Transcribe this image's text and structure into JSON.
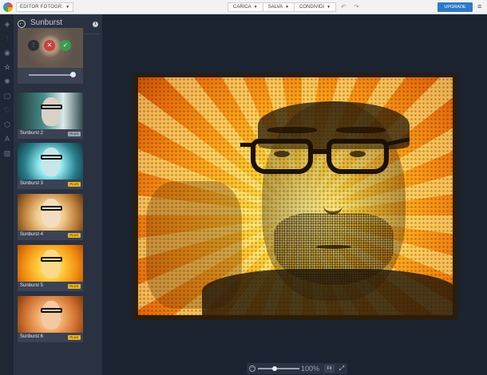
{
  "topbar": {
    "app_select": "EDITOR FOTOGR.",
    "menus": [
      {
        "label": "CARICA"
      },
      {
        "label": "SALVA"
      },
      {
        "label": "CONDIVIDI"
      }
    ],
    "undo_icon": "undo-icon",
    "redo_icon": "redo-icon",
    "upgrade_label": "UPGRADE",
    "menu_icon": "hamburger-icon",
    "upgrade_color": "#2d79c7"
  },
  "rail": {
    "icons": [
      "layers-icon",
      "adjust-icon",
      "eye-icon",
      "star-icon",
      "sun-icon",
      "frame-icon",
      "heart-icon",
      "badge-icon",
      "text-icon",
      "texture-icon"
    ],
    "active": "star-icon"
  },
  "panel": {
    "title": "Sunburst",
    "back_icon": "back-arrow-icon",
    "info_icon": "info-icon",
    "selected": {
      "adjust_icon": "sliders-icon",
      "cancel_icon": "close-icon",
      "apply_icon": "check-icon",
      "intensity": 0.95
    },
    "effects": [
      {
        "label": "Sunburst 2",
        "badge": "PLUS"
      },
      {
        "label": "Sunburst 3",
        "badge": "PLUS"
      },
      {
        "label": "Sunburst 4",
        "badge": "PLUS"
      },
      {
        "label": "Sunburst 5",
        "badge": "PLUS"
      },
      {
        "label": "Sunburst 6",
        "badge": "PLUS"
      }
    ]
  },
  "zoom": {
    "value": "100%",
    "fit_label": "Fit",
    "level": 0.45
  }
}
